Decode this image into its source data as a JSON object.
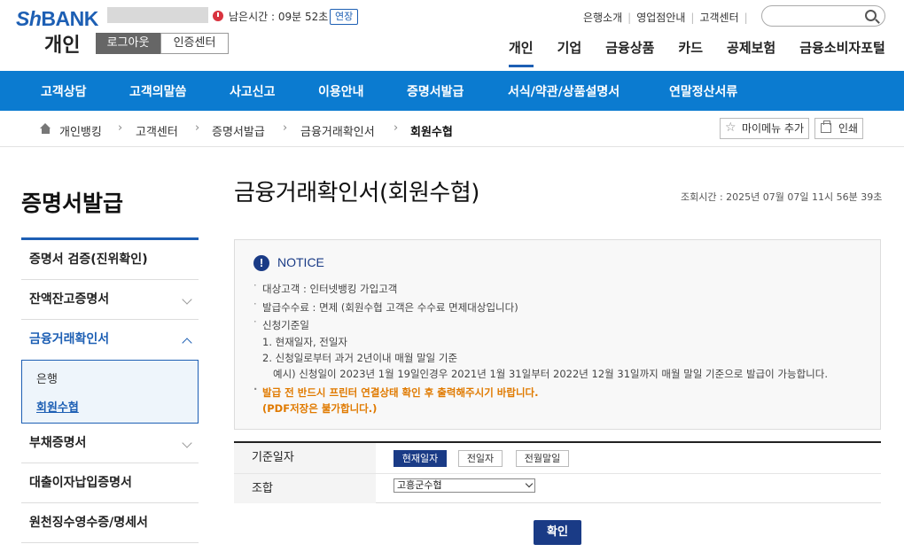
{
  "header": {
    "logo_sh": "Sh",
    "logo_bank": "BANK",
    "session_label": "남은시간 : 09분 52초",
    "extend_label": "연장",
    "site_title": "개인",
    "logout_label": "로그아웃",
    "cert_center_label": "인증센터",
    "util_links": [
      "은행소개",
      "영업점안내",
      "고객센터"
    ],
    "gnb": [
      "개인",
      "기업",
      "금융상품",
      "카드",
      "공제보험",
      "금융소비자포털"
    ],
    "gnb_active": "개인"
  },
  "navbar": {
    "items": [
      "고객상담",
      "고객의말씀",
      "사고신고",
      "이용안내",
      "증명서발급",
      "서식/약관/상품설명서",
      "연말정산서류"
    ]
  },
  "breadcrumb": {
    "items": [
      "개인뱅킹",
      "고객센터",
      "증명서발급",
      "금융거래확인서",
      "회원수협"
    ],
    "mymenu_label": "마이메뉴 추가",
    "print_label": "인쇄"
  },
  "sidebar": {
    "title": "증명서발급",
    "items": [
      "증명서 검증(진위확인)",
      "잔액잔고증명서",
      "금융거래확인서",
      "부채증명서",
      "대출이자납입증명서",
      "원천징수영수증/명세서"
    ],
    "sub_items": [
      "은행",
      "회원수협"
    ]
  },
  "main": {
    "title": "금융거래확인서(회원수협)",
    "view_time": "조회시간 : 2025년 07월 07일 11시 56분 39초",
    "notice": {
      "title": "NOTICE",
      "lines": [
        "대상고객 : 인터넷뱅킹 가입고객",
        "발급수수료 : 면제 (회원수협 고객은 수수료 면제대상입니다)",
        "신청기준일",
        "1. 현재일자, 전일자",
        "2. 신청일로부터 과거 2년이내 매월 말일 기준",
        "예시) 신청일이 2023년 1월 19일인경우 2021년 1월 31일부터 2022년 12월 31일까지 매월 말일 기준으로 발급이 가능합니다.",
        "발급 전 반드시 프린터 연결상태 확인 후 출력해주시기 바랍니다.",
        "(PDF저장은 불가합니다.)"
      ]
    },
    "form": {
      "base_date_label": "기준일자",
      "base_date_options": [
        "현재일자",
        "전일자",
        "전월말일"
      ],
      "union_label": "조합",
      "union_selected": "고흥군수협"
    },
    "confirm_label": "확인"
  },
  "colors": {
    "brand_blue": "#1d5fb4",
    "navbar_blue": "#0b7bd0",
    "navy": "#1a3b86",
    "warning_orange": "#e07a00",
    "timer_red": "#d9333f"
  }
}
